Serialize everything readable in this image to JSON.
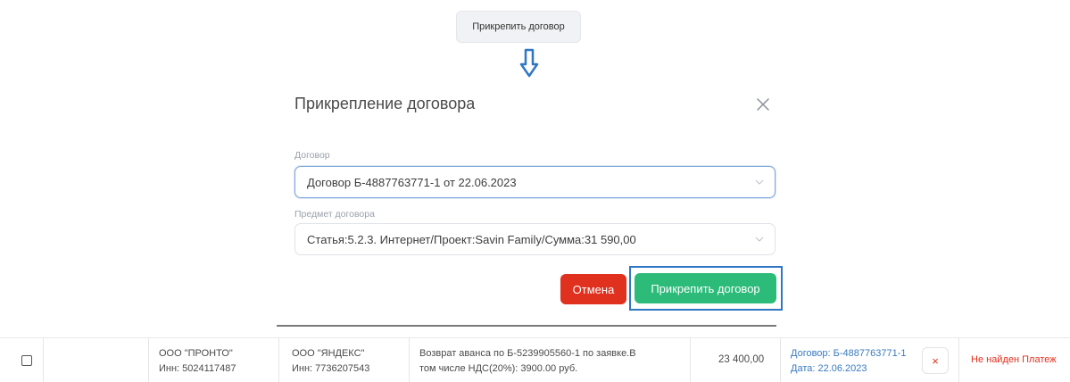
{
  "tooltip": {
    "label": "Прикрепить договор"
  },
  "modal": {
    "title": "Прикрепление договора",
    "contract_label": "Договор",
    "contract_value": "Договор Б-4887763771-1 от 22.06.2023",
    "subject_label": "Предмет договора",
    "subject_value": "Статья:5.2.3. Интернет/Проект:Savin Family/Сумма:31 590,00",
    "cancel_label": "Отмена",
    "attach_label": "Прикрепить договор"
  },
  "row": {
    "payer_name": "ООО \"ПРОНТО\"",
    "payer_inn": "Инн: 5024117487",
    "payee_name": "ООО \"ЯНДЕКС\"",
    "payee_inn": "Инн: 7736207543",
    "description_line1": "Возврат аванса по Б-5239905560-1 по заявке.В",
    "description_line2": "том числе НДС(20%): 3900.00 руб.",
    "amount": "23 400,00",
    "contract_link": "Договор: Б-4887763771-1",
    "date_link": "Дата: 22.06.2023",
    "remove_symbol": "×",
    "status": "Не найден Платеж"
  },
  "colors": {
    "cancel": "#e0301e",
    "attach": "#2dbb7a",
    "highlight": "#2f77c4",
    "link": "#3a7bbf",
    "arrow": "#2f77c4"
  },
  "icons": [
    "arrow-down-icon",
    "close-icon",
    "chevron-down-icon",
    "remove-icon"
  ]
}
